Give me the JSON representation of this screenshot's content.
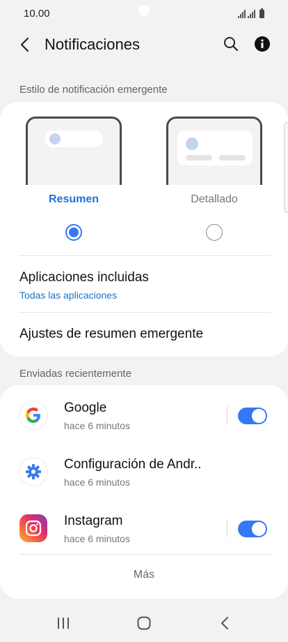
{
  "status_bar": {
    "time": "10.00"
  },
  "header": {
    "title": "Notificaciones"
  },
  "popup_style": {
    "section_label": "Estilo de notificación emergente",
    "options": [
      {
        "label": "Resumen",
        "selected": true
      },
      {
        "label": "Detallado",
        "selected": false
      }
    ],
    "included_apps": {
      "title": "Aplicaciones incluidas",
      "value": "Todas las aplicaciones"
    },
    "summary_settings": {
      "title": "Ajustes de resumen emergente"
    }
  },
  "recent": {
    "section_label": "Enviadas recientemente",
    "apps": [
      {
        "name": "Google",
        "time": "hace 6 minutos",
        "icon": "google-icon",
        "enabled": true
      },
      {
        "name": "Configuración de Andr..",
        "time": "hace 6 minutos",
        "icon": "settings-gear-icon"
      },
      {
        "name": "Instagram",
        "time": "hace 6 minutos",
        "icon": "instagram-icon",
        "enabled": true
      }
    ],
    "more_label": "Más"
  },
  "colors": {
    "accent": "#3478f6",
    "link": "#1a73c8",
    "background": "#f2f2f2"
  }
}
